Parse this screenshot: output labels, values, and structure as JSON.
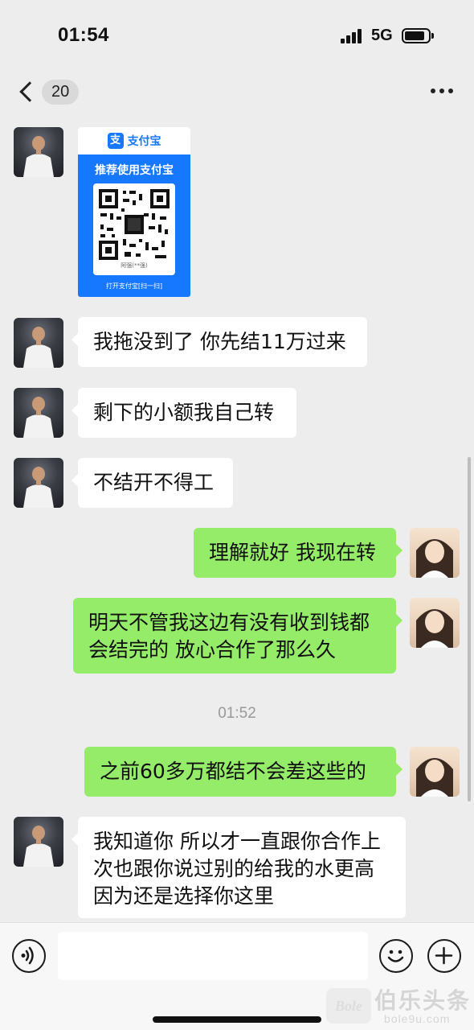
{
  "status_bar": {
    "time": "01:54",
    "network": "5G",
    "icons": [
      "signal-icon",
      "battery-icon"
    ]
  },
  "nav": {
    "unread_count": "20",
    "icons": [
      "back-chevron-icon",
      "more-icon"
    ]
  },
  "payment_card": {
    "brand": "支付宝",
    "recommend_text": "推荐使用支付宝",
    "qr_name": "阿强(**强)",
    "open_text": "打开支付宝[扫一扫]",
    "accent_color": "#1677ff"
  },
  "messages": [
    {
      "side": "left",
      "text": "我拖没到了 你先结11万过来"
    },
    {
      "side": "left",
      "text": "剩下的小额我自己转"
    },
    {
      "side": "left",
      "text": "不结开不得工"
    },
    {
      "side": "right",
      "text": "理解就好 我现在转"
    },
    {
      "side": "right",
      "lines": [
        "明天不管我这边有没有收到钱都",
        "会结完的 放心合作了那么久"
      ]
    },
    {
      "side": "right",
      "text": "之前60多万都结不会差这些的"
    },
    {
      "side": "left",
      "lines": [
        "我知道你 所以才一直跟你合作上",
        "次也跟你说过别的给我的水更高",
        "因为还是选择你这里"
      ]
    }
  ],
  "timestamp": "01:52",
  "colors": {
    "background": "#ededed",
    "incoming_bubble": "#ffffff",
    "outgoing_bubble": "#95ec69"
  },
  "input_bar": {
    "message_value": "",
    "icons": [
      "voice-icon",
      "emoji-icon",
      "add-icon"
    ]
  },
  "watermark": {
    "main": "伯乐头条",
    "sub": "bole9u.com",
    "logo_text": "Bole"
  }
}
